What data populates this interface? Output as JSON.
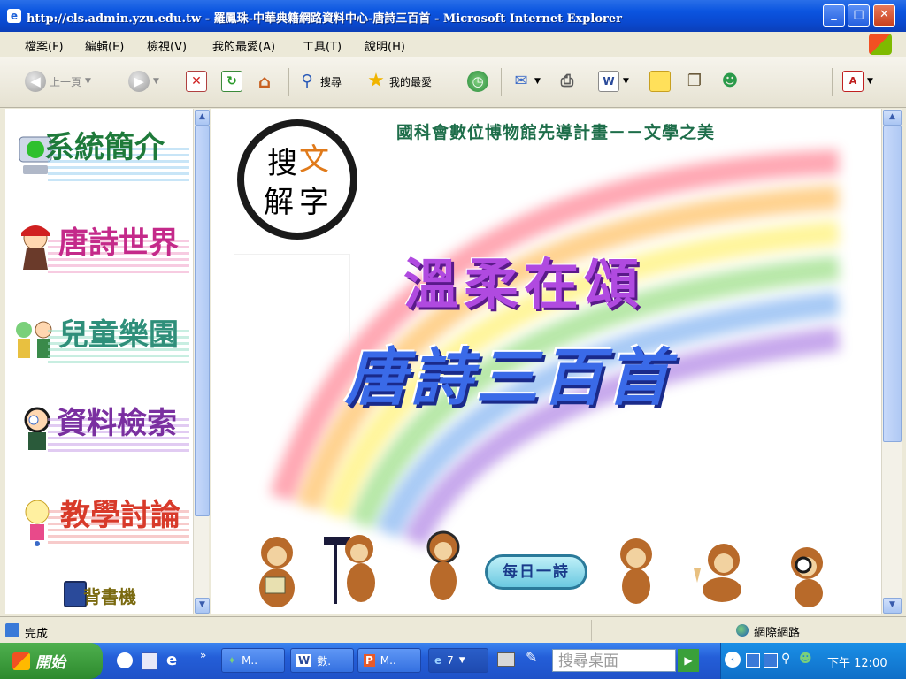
{
  "window": {
    "title": "http://cls.admin.yzu.edu.tw - 羅鳳珠-中華典籍網路資料中心-唐詩三百首 - Microsoft Internet Explorer"
  },
  "menubar": {
    "items": [
      "檔案(F)",
      "編輯(E)",
      "檢視(V)",
      "我的最愛(A)",
      "工具(T)",
      "說明(H)"
    ]
  },
  "toolbar": {
    "back_label": "上一頁",
    "search_label": "搜尋",
    "favorites_label": "我的最愛"
  },
  "sidebar": {
    "items": [
      {
        "label": "系統簡介",
        "icon": "computer-mascot-icon",
        "color": "#2f8f3a"
      },
      {
        "label": "唐詩世界",
        "icon": "poet-mascot-icon",
        "color": "#c42a8a"
      },
      {
        "label": "兒童樂園",
        "icon": "children-mascot-icon",
        "color": "#2f8f7a"
      },
      {
        "label": "資料檢索",
        "icon": "boy-mascot-icon",
        "color": "#7a2fa0"
      },
      {
        "label": "教學討論",
        "icon": "girl-mascot-icon",
        "color": "#d83a2a"
      },
      {
        "label": "背書機",
        "icon": "book-icon",
        "color": "#7a6a10"
      }
    ]
  },
  "main": {
    "header": "國科會數位博物館先導計畫－－文學之美",
    "logo_text": [
      "搜",
      "文",
      "解",
      "字"
    ],
    "subtitle": "溫柔在頌",
    "title": "唐詩三百首",
    "daily_button": "每日一詩"
  },
  "statusbar": {
    "status": "完成",
    "zone": "網際網路"
  },
  "taskbar": {
    "start_label": "開始",
    "tasks": [
      "M..",
      "數.",
      "M..",
      "7"
    ],
    "search_placeholder": "搜尋桌面",
    "clock": "下午 12:00"
  },
  "colors": {
    "titlebar": "#0b55e0",
    "rainbow": [
      "#ff8a9a",
      "#ffc36a",
      "#fff27a",
      "#9fe08a",
      "#8ab8f2",
      "#b48ae6"
    ],
    "title_blue": "#2a4fc8",
    "subtitle_purple": "#9a3ad0"
  }
}
